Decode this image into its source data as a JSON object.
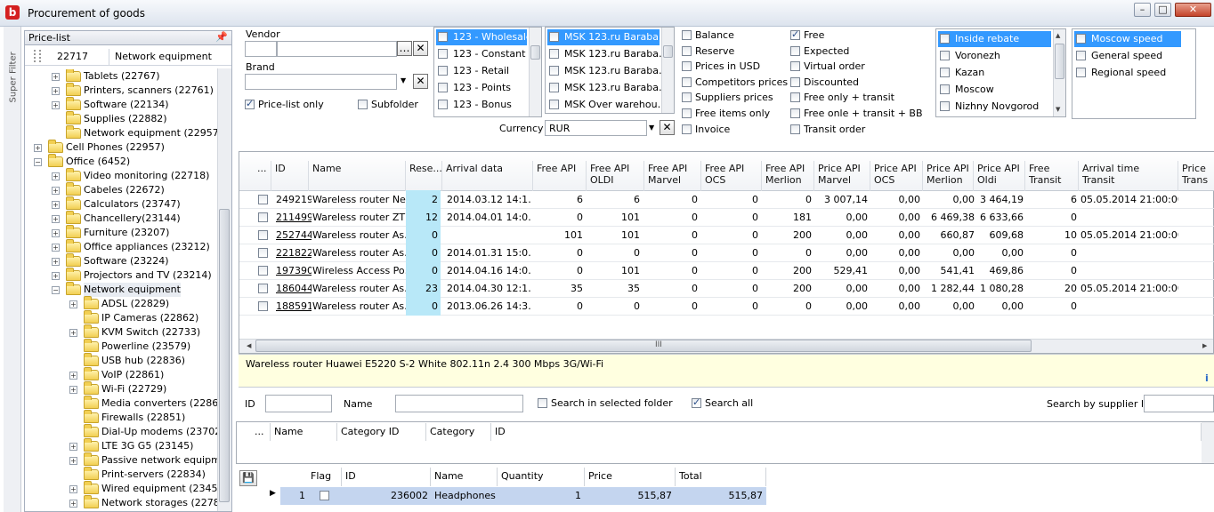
{
  "window": {
    "title": "Procurement of goods"
  },
  "super_filter": {
    "label": "Super Filter"
  },
  "price_list": {
    "header": "Price-list",
    "pin": "📌",
    "id": "22717",
    "name": "Network equipment",
    "tree": [
      {
        "label": "Tablets (22767)"
      },
      {
        "label": "Printers, scanners (22761)"
      },
      {
        "label": "Software (22134)"
      },
      {
        "label": "Supplies (22882)"
      },
      {
        "label": "Network equipment (22957)"
      },
      {
        "label": "Cell Phones (22957)"
      },
      {
        "label": "Office (6452)"
      },
      {
        "label": "Video monitoring (22718)"
      },
      {
        "label": "Cabeles (22672)"
      },
      {
        "label": "Calculators (23747)"
      },
      {
        "label": "Chancellery(23144)"
      },
      {
        "label": "Furniture (23207)"
      },
      {
        "label": "Office appliances (23212)"
      },
      {
        "label": "Software (23224)"
      },
      {
        "label": "Projectors and TV (23214)"
      },
      {
        "label": "Network equipment"
      },
      {
        "label": "ADSL (22829)"
      },
      {
        "label": "IP Cameras (22862)"
      },
      {
        "label": "KVM Switch (22733)"
      },
      {
        "label": "Powerline (23579)"
      },
      {
        "label": "USB hub (22836)"
      },
      {
        "label": "VoIP (22861)"
      },
      {
        "label": "Wi-Fi (22729)"
      },
      {
        "label": "Media converters (22860)"
      },
      {
        "label": "Firewalls (22851)"
      },
      {
        "label": "Dial-Up modems (23702)"
      },
      {
        "label": "LTE 3G G5 (23145)"
      },
      {
        "label": "Passive network equipmen"
      },
      {
        "label": "Print-servers (22834)"
      },
      {
        "label": "Wired equipment (23458)"
      },
      {
        "label": "Network storages (22784)"
      }
    ]
  },
  "filters": {
    "vendor_label": "Vendor",
    "brand_label": "Brand",
    "price_list_only": "Price-list only",
    "subfolder": "Subfolder",
    "currency_label": "Currency",
    "currency_value": "RUR",
    "ellipsis": "…",
    "clear": "✕",
    "dropdown": "▼",
    "price_types": [
      "123 - Wholesale",
      "123 - Constant",
      "123 - Retail",
      "123 - Points",
      "123 - Bonus"
    ],
    "warehouses": [
      "MSK 123.ru Baraba…",
      "MSK 123.ru Baraba…",
      "MSK 123.ru Baraba…",
      "MSK 123.ru Baraba…",
      "MSK Over warehou…"
    ],
    "flags_col1": [
      "Balance",
      "Reserve",
      "Prices in USD",
      "Competitors prices",
      "Suppliers prices",
      "Free items only",
      "Invoice"
    ],
    "flags_col2": [
      "Free",
      "Expected",
      "Virtual order",
      "Discounted",
      "Free only + transit",
      "Free onle + transit + BB",
      "Transit order"
    ],
    "regions": [
      "Inside rebate",
      "Voronezh",
      "Kazan",
      "Moscow",
      "Nizhny Novgorod"
    ],
    "speeds": [
      "Moscow speed",
      "General speed",
      "Regional speed"
    ]
  },
  "grid": {
    "columns": [
      "...",
      "ID",
      "Name",
      "Rese...",
      "Arrival data",
      "Free API",
      "Free API OLDI",
      "Free API Marvel",
      "Free API OCS",
      "Free API Merlion",
      "Price API Marvel",
      "Price API OCS",
      "Price API Merlion",
      "Price API Oldi",
      "Free Transit",
      "Arrival time Transit",
      "Price Trans"
    ],
    "rows": [
      {
        "id": "249219",
        "name": "Wareless router Ne…",
        "reserve": "2",
        "arrival": "2014.03.12 14:1…",
        "free_api": "6",
        "free_oldi": "6",
        "free_marvel": "0",
        "free_ocs": "0",
        "free_merlion": "0",
        "price_marvel": "3 007,14",
        "price_ocs": "0,00",
        "price_merlion": "0,00",
        "price_oldi": "3 464,19",
        "free_transit": "6",
        "arrival_transit": "05.05.2014 21:00:00"
      },
      {
        "id": "211499",
        "name": "Wareless router ZT…",
        "reserve": "12",
        "arrival": "2014.04.01 14:0…",
        "free_api": "0",
        "free_oldi": "101",
        "free_marvel": "0",
        "free_ocs": "0",
        "free_merlion": "181",
        "price_marvel": "0,00",
        "price_ocs": "0,00",
        "price_merlion": "6 469,38",
        "price_oldi": "6 633,66",
        "free_transit": "0",
        "arrival_transit": ""
      },
      {
        "id": "252744",
        "name": "Wareless router As…",
        "reserve": "0",
        "arrival": "",
        "free_api": "101",
        "free_oldi": "101",
        "free_marvel": "0",
        "free_ocs": "0",
        "free_merlion": "200",
        "price_marvel": "0,00",
        "price_ocs": "0,00",
        "price_merlion": "660,87",
        "price_oldi": "609,68",
        "free_transit": "10",
        "arrival_transit": "05.05.2014 21:00:00"
      },
      {
        "id": "221822",
        "name": "Wareless router As…",
        "reserve": "0",
        "arrival": "2014.01.31 15:0…",
        "free_api": "0",
        "free_oldi": "0",
        "free_marvel": "0",
        "free_ocs": "0",
        "free_merlion": "0",
        "price_marvel": "0,00",
        "price_ocs": "0,00",
        "price_merlion": "0,00",
        "price_oldi": "0,00",
        "free_transit": "0",
        "arrival_transit": ""
      },
      {
        "id": "197390",
        "name": "Wireless Access Po…",
        "reserve": "0",
        "arrival": "2014.04.16 14:0…",
        "free_api": "0",
        "free_oldi": "101",
        "free_marvel": "0",
        "free_ocs": "0",
        "free_merlion": "200",
        "price_marvel": "529,41",
        "price_ocs": "0,00",
        "price_merlion": "541,41",
        "price_oldi": "469,86",
        "free_transit": "0",
        "arrival_transit": ""
      },
      {
        "id": "186044",
        "name": "Wareless router As…",
        "reserve": "23",
        "arrival": "2014.04.30 12:1…",
        "free_api": "35",
        "free_oldi": "35",
        "free_marvel": "0",
        "free_ocs": "0",
        "free_merlion": "200",
        "price_marvel": "0,00",
        "price_ocs": "0,00",
        "price_merlion": "1 282,44",
        "price_oldi": "1 080,28",
        "free_transit": "20",
        "arrival_transit": "05.05.2014 21:00:00"
      },
      {
        "id": "188591",
        "name": "Wareless router As…",
        "reserve": "0",
        "arrival": "2013.06.26 14:3…",
        "free_api": "0",
        "free_oldi": "0",
        "free_marvel": "0",
        "free_ocs": "0",
        "free_merlion": "0",
        "price_marvel": "0,00",
        "price_ocs": "0,00",
        "price_merlion": "0,00",
        "price_oldi": "0,00",
        "free_transit": "0",
        "arrival_transit": ""
      }
    ],
    "scroll_grip": "III"
  },
  "description": {
    "text": "Wareless  router Huawei E5220 S-2 White 802.11n 2.4 300 Mbps 3G/Wi-Fi",
    "info": "i"
  },
  "search": {
    "id_label": "ID",
    "name_label": "Name",
    "in_folder": "Search in selected folder",
    "search_all": "Search all",
    "by_supplier": "Search by supplier ID"
  },
  "category_grid": {
    "columns": [
      "...",
      "Name",
      "Category ID",
      "Category",
      "ID"
    ]
  },
  "order": {
    "columns": [
      "Flag",
      "ID",
      "Name",
      "Quantity",
      "Price",
      "Total"
    ],
    "rows": [
      {
        "num": "1",
        "id": "236002",
        "name": "Headphones",
        "quantity": "1",
        "price": "515,87",
        "total": "515,87"
      }
    ],
    "save_icon": "💾",
    "row_pointer": "▶"
  }
}
